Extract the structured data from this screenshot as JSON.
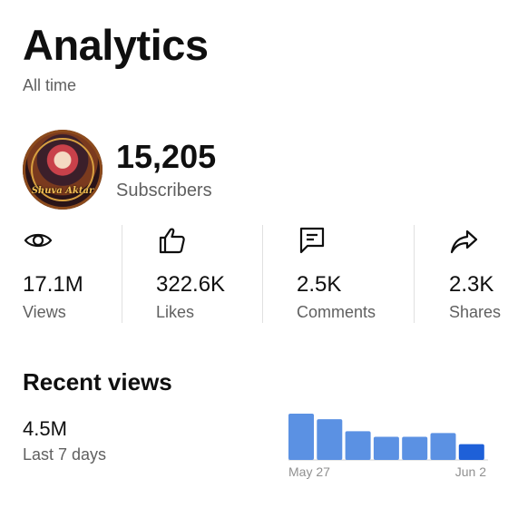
{
  "header": {
    "title": "Analytics",
    "period": "All time"
  },
  "channel": {
    "avatar_text": "Shuva Aktar",
    "subscriber_count": "15,205",
    "subscriber_label": "Subscribers"
  },
  "stats": [
    {
      "icon": "eye-icon",
      "value": "17.1M",
      "label": "Views"
    },
    {
      "icon": "thumbs-up-icon",
      "value": "322.6K",
      "label": "Likes"
    },
    {
      "icon": "comment-icon",
      "value": "2.5K",
      "label": "Comments"
    },
    {
      "icon": "share-icon",
      "value": "2.3K",
      "label": "Shares"
    }
  ],
  "recent": {
    "title": "Recent views",
    "value": "4.5M",
    "label": "Last 7 days"
  },
  "chart_data": {
    "type": "bar",
    "categories": [
      "",
      "",
      "",
      "",
      "",
      "",
      ""
    ],
    "values": [
      100,
      88,
      62,
      50,
      50,
      58,
      34
    ],
    "x_start_label": "May 27",
    "x_end_label": "Jun 2",
    "colors": {
      "bar": "#5b91e3",
      "last_bar": "#1e60d8",
      "baseline": "#d0d0d0"
    }
  }
}
